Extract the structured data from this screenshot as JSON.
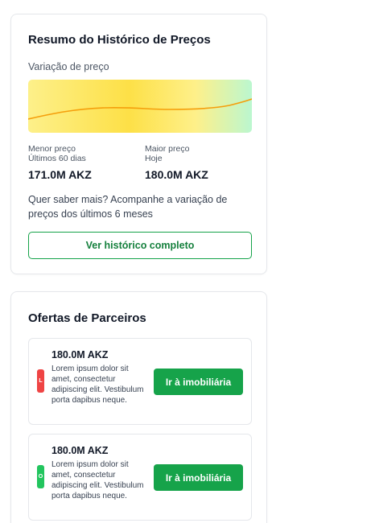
{
  "history": {
    "title": "Resumo do Histórico de Preços",
    "subtitle": "Variação de preço",
    "chart": {
      "line_color": "#f59e0b"
    },
    "low": {
      "label": "Menor preço",
      "period": "Últimos 60 dias",
      "value": "171.0M AKZ"
    },
    "high": {
      "label": "Maior preço",
      "period": "Hoje",
      "value": "180.0M AKZ"
    },
    "info_text": "Quer saber mais? Acompanhe a variação de preços dos últimos 6 meses",
    "button_label": "Ver histórico completo"
  },
  "partners": {
    "title": "Ofertas de Parceiros",
    "offers": [
      {
        "tag": "L",
        "tag_color": "#ef4444",
        "price": "180.0M AKZ",
        "description": "Lorem ipsum dolor sit amet, consectetur adipiscing elit. Vestibulum porta dapibus neque.",
        "button_label": "Ir à imobiliária"
      },
      {
        "tag": "O",
        "tag_color": "#22c55e",
        "price": "180.0M AKZ",
        "description": "Lorem ipsum dolor sit amet, consectetur adipiscing elit. Vestibulum porta dapibus neque.",
        "button_label": "Ir à imobiliária"
      }
    ]
  },
  "colors": {
    "accent": "#16a34a"
  }
}
